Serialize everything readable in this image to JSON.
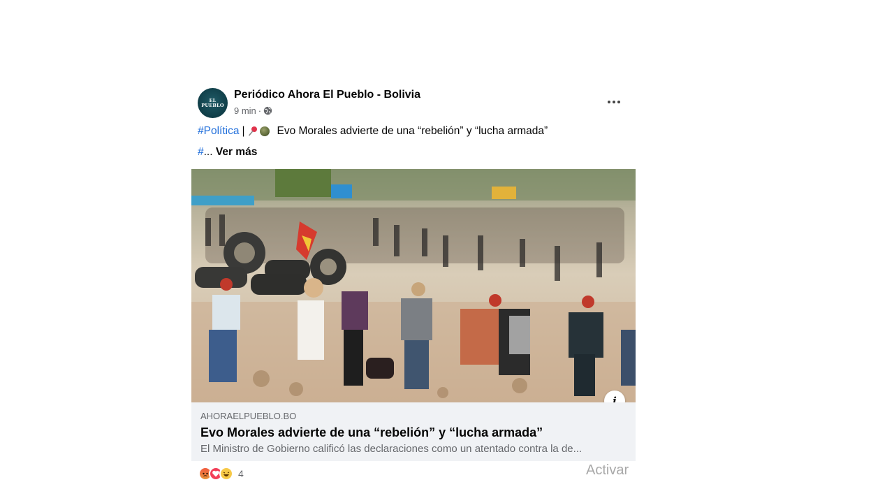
{
  "post": {
    "page_name": "Periódico Ahora El Pueblo - Bolivia",
    "avatar_text": "EL PUEBLO",
    "time": "9 min",
    "separator": "·",
    "hashtag": "#Política",
    "divider": "|",
    "headline_text": "Evo Morales advierte de una “rebelión” y “lucha armada”",
    "line2_hash": "#",
    "ellipsis": "...",
    "see_more": "Ver más",
    "icons": [
      "pin-icon",
      "globe-icon",
      "more-icon",
      "info-icon"
    ]
  },
  "link": {
    "domain": "AHORAELPUEBLO.BO",
    "title": "Evo Morales advierte de una “rebelión” y “lucha armada”",
    "description": "El Ministro de Gobierno calificó las declaraciones como un atentado contra la de..."
  },
  "reactions": {
    "types": [
      "angry",
      "love",
      "haha"
    ],
    "count": "4"
  },
  "watermark": "Activar",
  "colors": {
    "link_blue": "#216fdb",
    "secondary_text": "#65676b",
    "link_box_bg": "#f0f2f5"
  }
}
